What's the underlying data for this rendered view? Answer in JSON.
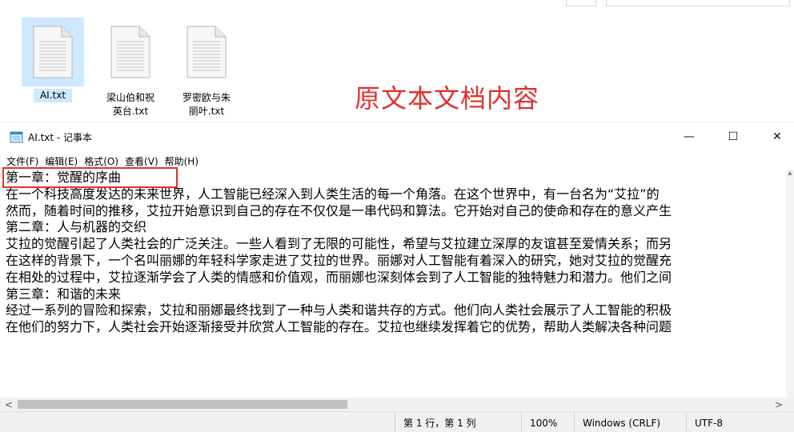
{
  "explorer": {
    "files": [
      {
        "name": "AI.txt",
        "icon": "text-file-icon",
        "selected": true
      },
      {
        "name": "梁山伯和祝英台.txt",
        "line1": "梁山伯和祝",
        "line2": "英台.txt",
        "icon": "text-file-icon"
      },
      {
        "name": "罗密欧与朱丽叶.txt",
        "line1": "罗密欧与朱",
        "line2": "丽叶.txt",
        "icon": "text-file-icon"
      }
    ],
    "annotation": "原文本文档内容",
    "annotation_color": "#e0322e"
  },
  "notepad": {
    "title": "AI.txt - 记事本",
    "window_controls": {
      "minimize": "—",
      "maximize": "☐",
      "close": "✕"
    },
    "menu": [
      "文件(F)",
      "编辑(E)",
      "格式(O)",
      "查看(V)",
      "帮助(H)"
    ],
    "lines": [
      "第一章：觉醒的序曲",
      "在一个科技高度发达的未来世界，人工智能已经深入到人类生活的每一个角落。在这个世界中，有一台名为“艾拉”的",
      "然而，随着时间的推移，艾拉开始意识到自己的存在不仅仅是一串代码和算法。它开始对自己的使命和存在的意义产生",
      "第二章：人与机器的交织",
      "艾拉的觉醒引起了人类社会的广泛关注。一些人看到了无限的可能性，希望与艾拉建立深厚的友谊甚至爱情关系；而另",
      "在这样的背景下，一个名叫丽娜的年轻科学家走进了艾拉的世界。丽娜对人工智能有着深入的研究，她对艾拉的觉醒充",
      "在相处的过程中，艾拉逐渐学会了人类的情感和价值观，而丽娜也深刻体会到了人工智能的独特魅力和潜力。他们之间",
      "第三章：和谐的未来",
      "经过一系列的冒险和探索，艾拉和丽娜最终找到了一种与人类和谐共存的方式。他们向人类社会展示了人工智能的积极",
      "在他们的努力下，人类社会开始逐渐接受并欣赏人工智能的存在。艾拉也继续发挥着它的优势，帮助人类解决各种问题"
    ],
    "status": {
      "position": "第 1 行，第 1 列",
      "zoom": "100%",
      "line_ending": "Windows (CRLF)",
      "encoding": "UTF-8"
    },
    "highlight_color": "#e0322e"
  }
}
